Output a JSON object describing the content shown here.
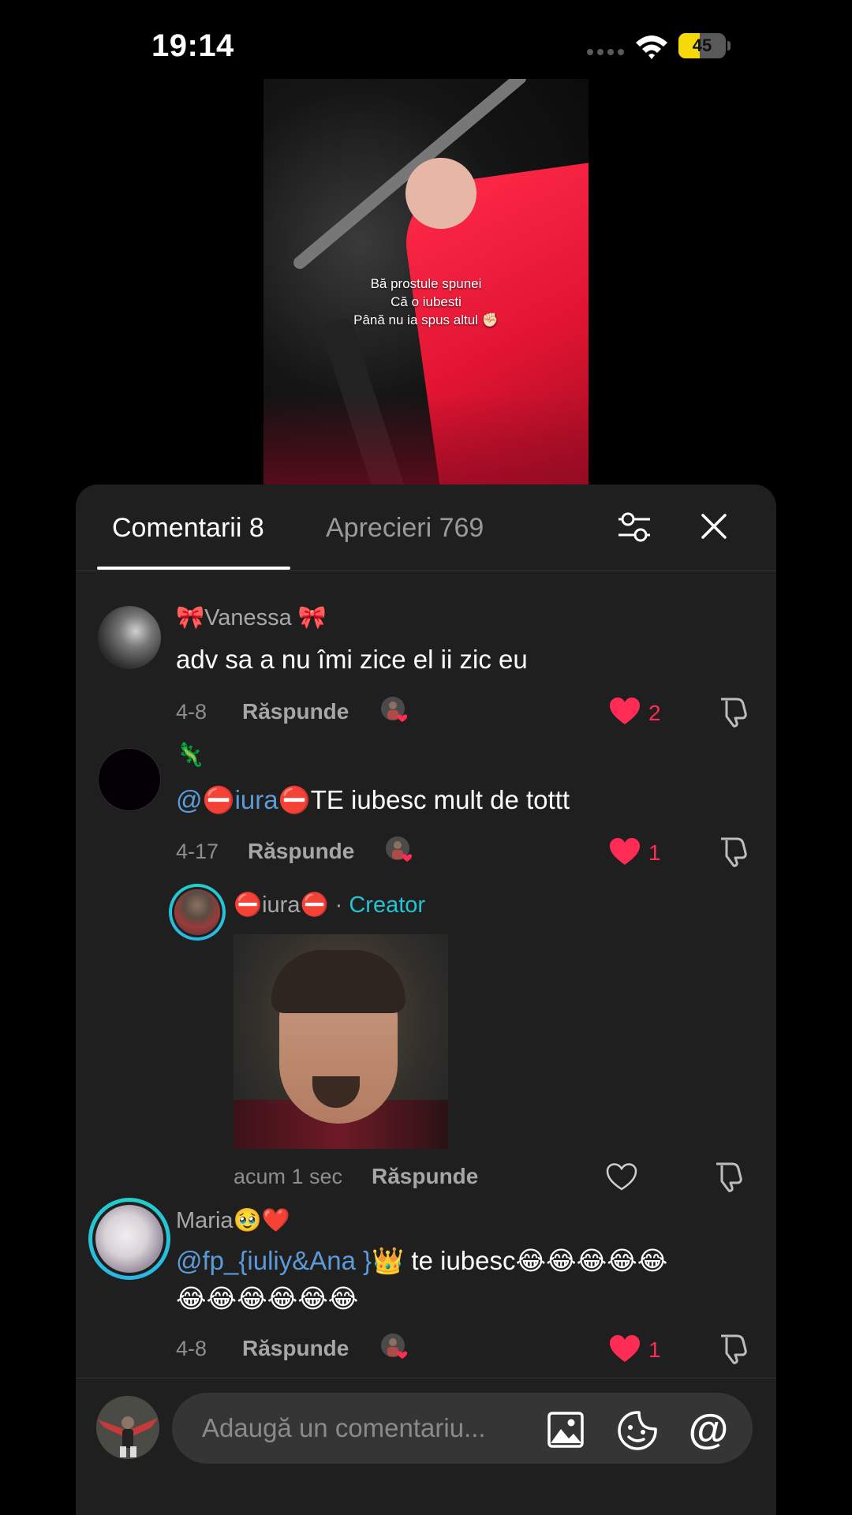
{
  "status_bar": {
    "time": "19:14",
    "battery_level": "45",
    "battery_percent": 45,
    "battery_color": "#f5d90a"
  },
  "video": {
    "caption_lines": [
      "Bă prostule spunei",
      "Că o iubesti",
      "Până nu ia spus altul ✊🏻"
    ]
  },
  "panel": {
    "tabs": [
      {
        "label": "Comentarii 8",
        "active": true
      },
      {
        "label": "Aprecieri 769",
        "active": false
      }
    ],
    "filter_icon": "sliders-icon",
    "close_icon": "close-icon"
  },
  "comments": [
    {
      "username": "🎀Vanessa 🎀",
      "text": "adv sa a nu îmi zice el ii zic eu",
      "date": "4-8",
      "reply_label": "Răspunde",
      "likes": "2",
      "liked": true
    },
    {
      "username": "🦎",
      "mention": "@⛔️iura⛔️",
      "text": "TE iubesc mult de tottt",
      "date": "4-17",
      "reply_label": "Răspunde",
      "likes": "1",
      "liked": true,
      "replies": [
        {
          "username": "⛔️iura⛔️",
          "separator": " · ",
          "badge": "Creator",
          "media": "gif",
          "date": "acum 1 sec",
          "reply_label": "Răspunde",
          "liked": false
        }
      ]
    },
    {
      "username": "Maria🥹❤️",
      "mention": "@fp_{iuliy&Ana }👑",
      "text_line1": " te iubesc😂😂😂😂😂",
      "text_line2": "😂😂😂😂😂😂",
      "date": "4-8",
      "reply_label": "Răspunde",
      "likes": "1",
      "liked": true
    }
  ],
  "input": {
    "placeholder": "Adaugă un comentariu...",
    "icons": [
      "image-icon",
      "sticker-icon",
      "at-icon"
    ],
    "at_symbol": "@"
  },
  "colors": {
    "panel_bg": "#1f1f1f",
    "like_red": "#fe2c55",
    "mention_blue": "#5b9bd9",
    "creator_cyan": "#21c4d4"
  }
}
